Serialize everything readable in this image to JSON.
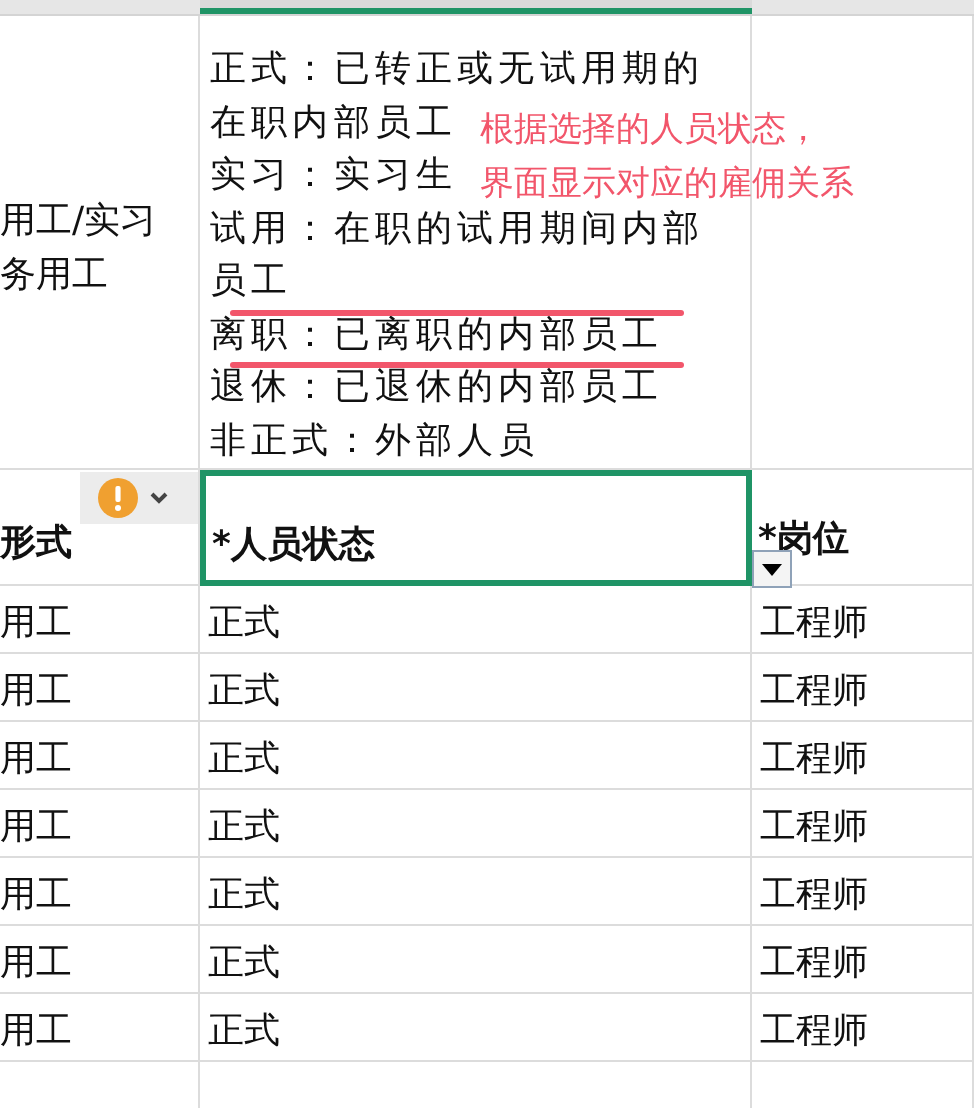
{
  "description_row": {
    "left_text_lines": [
      "用工/实习",
      "务用工"
    ],
    "lines": [
      {
        "text": "正式：已转正或无试用期的",
        "struck": false
      },
      {
        "text": "在职内部员工",
        "struck": false
      },
      {
        "text": "实习：实习生",
        "struck": false
      },
      {
        "text": "试用：在职的试用期间内部",
        "struck": false
      },
      {
        "text": "员工",
        "struck": false
      },
      {
        "text": "离职：已离职的内部员工",
        "struck": true
      },
      {
        "text": "退休：已退休的内部员工",
        "struck": true
      },
      {
        "text": "非正式：外部人员",
        "struck": false
      }
    ],
    "annotation_lines": [
      "根据选择的人员状态，",
      "界面显示对应的雇佣关系"
    ]
  },
  "header": [
    {
      "text": "形式",
      "selected": false
    },
    {
      "text": "*人员状态",
      "selected": true
    },
    {
      "text": "*岗位",
      "selected": false
    }
  ],
  "rows": [
    [
      "用工",
      "正式",
      "工程师"
    ],
    [
      "用工",
      "正式",
      "工程师"
    ],
    [
      "用工",
      "正式",
      "工程师"
    ],
    [
      "用工",
      "正式",
      "工程师"
    ],
    [
      "用工",
      "正式",
      "工程师"
    ],
    [
      "用工",
      "正式",
      "工程师"
    ],
    [
      "用工",
      "正式",
      "工程师"
    ]
  ]
}
